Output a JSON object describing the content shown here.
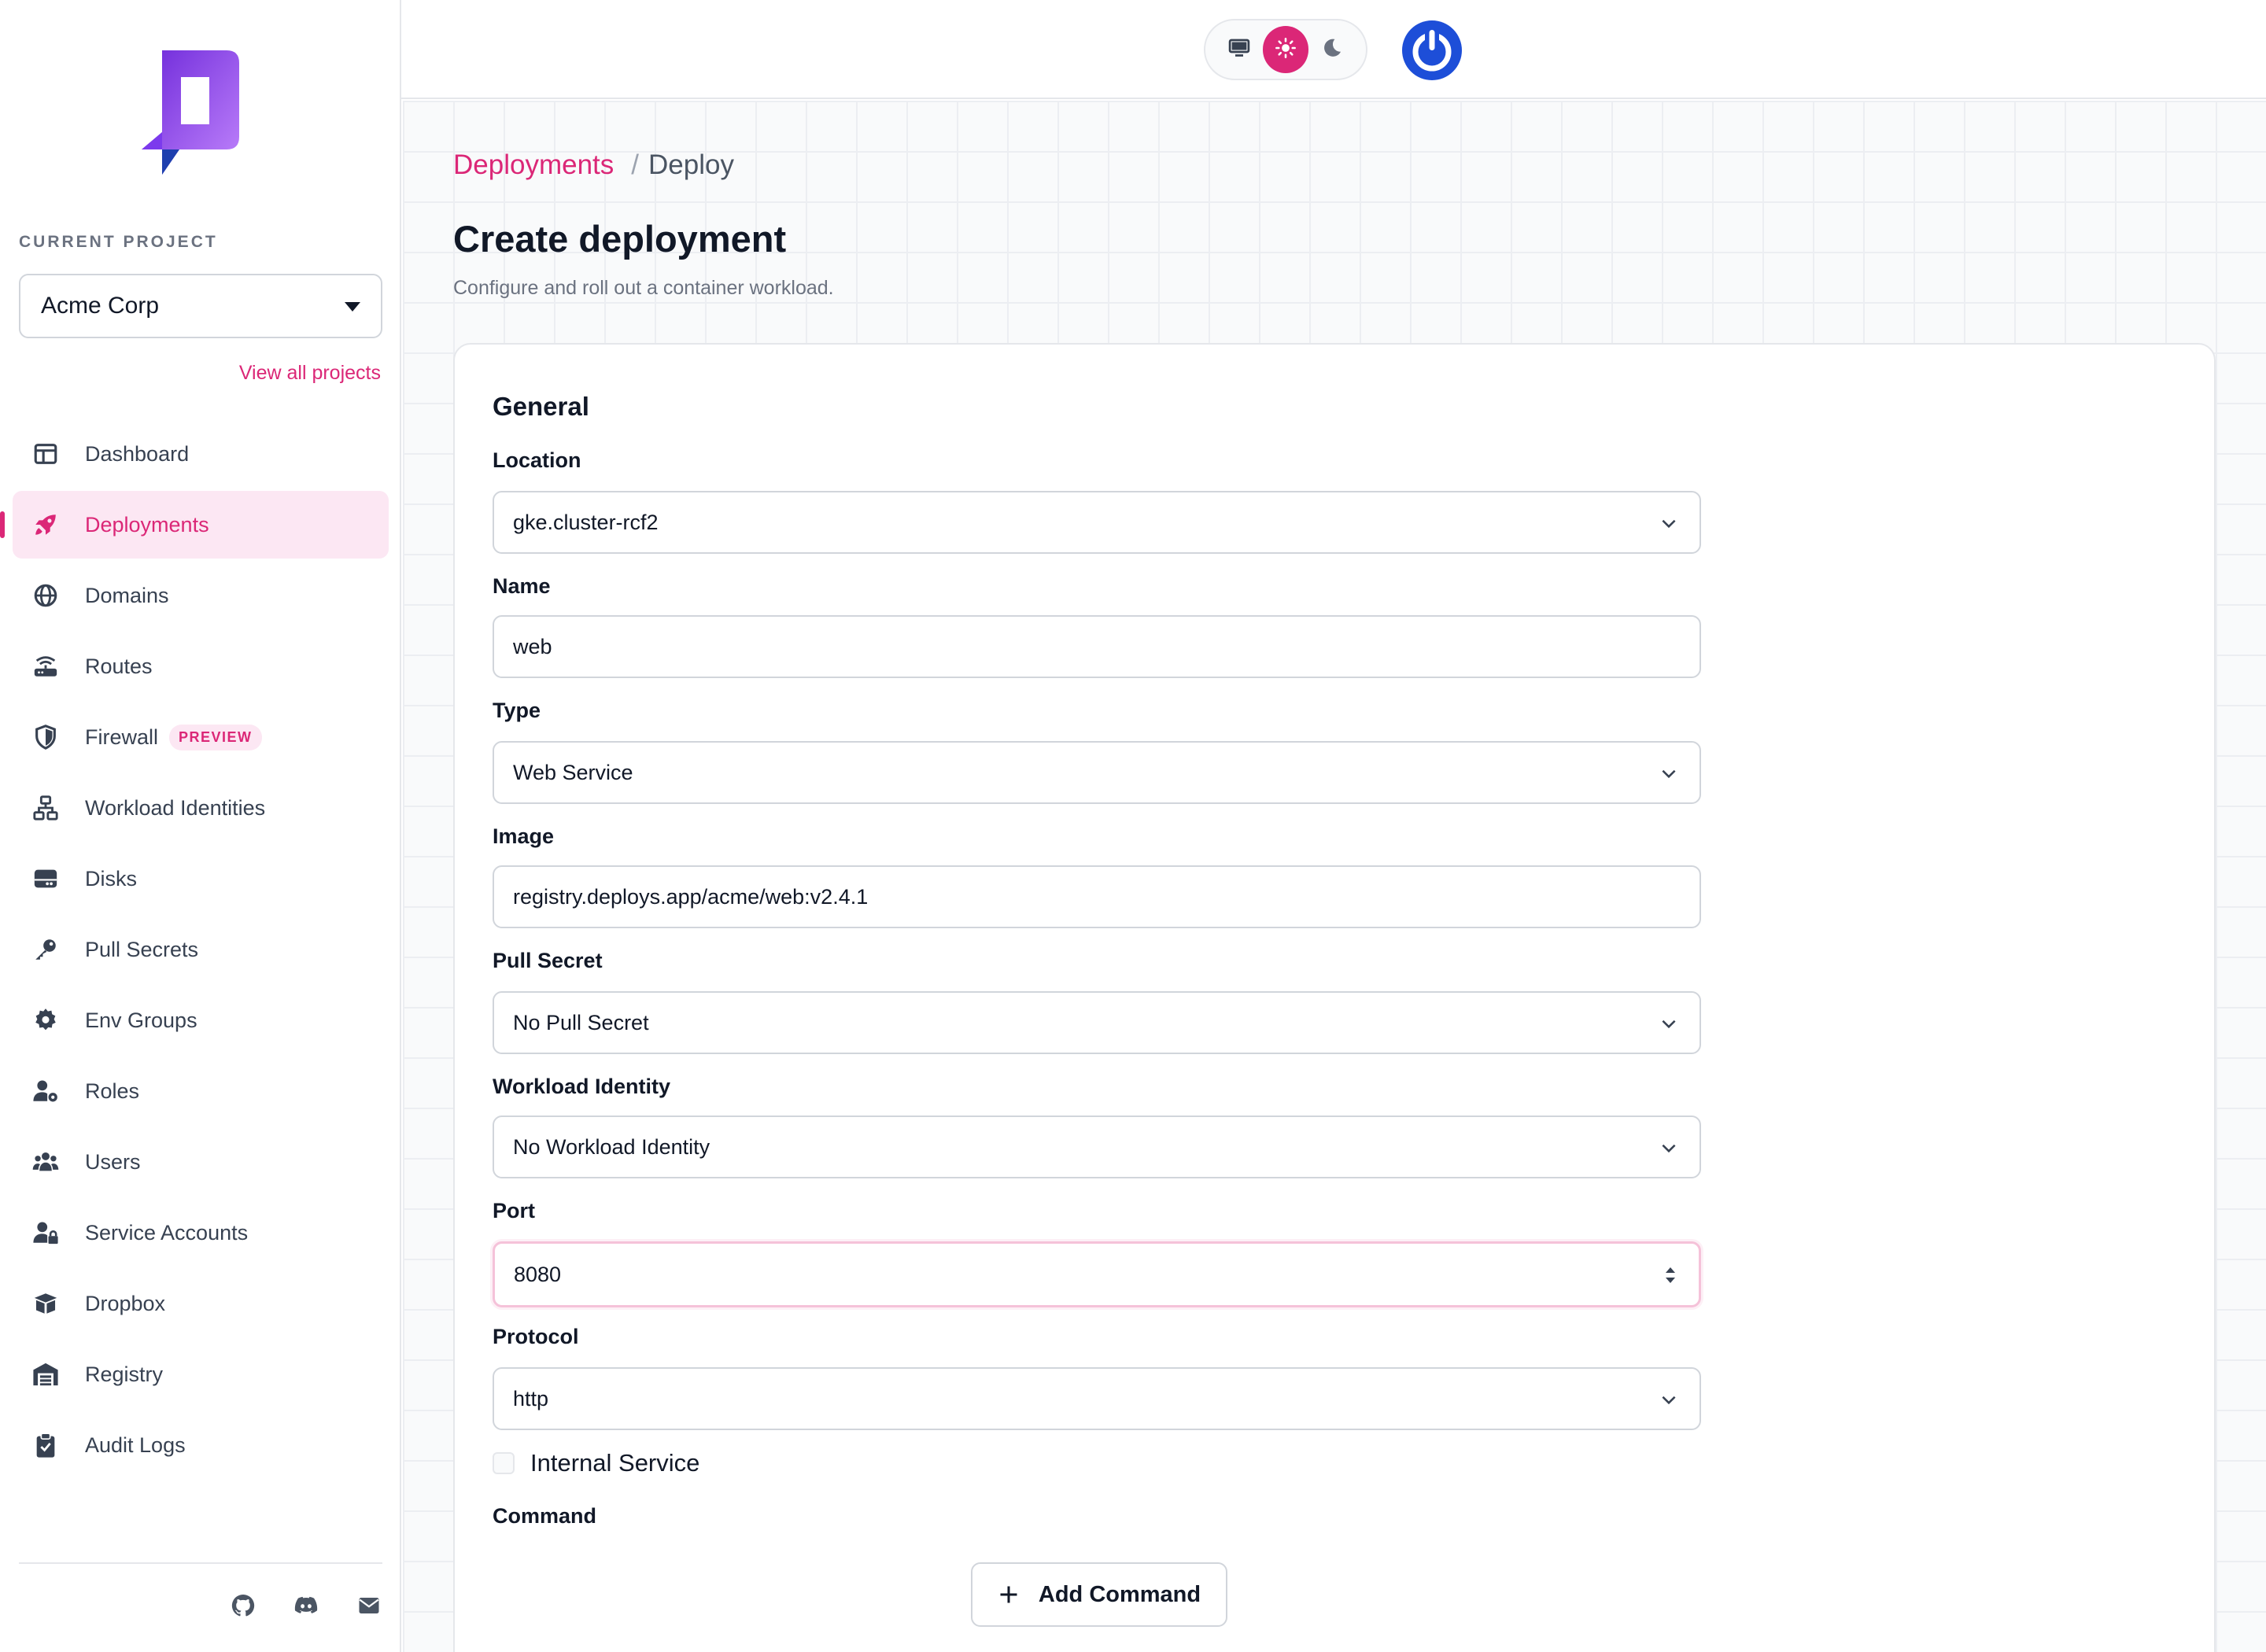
{
  "sidebar": {
    "current_project_label": "CURRENT PROJECT",
    "project": "Acme Corp",
    "view_all": "View all projects",
    "items": [
      {
        "label": "Dashboard",
        "icon": "dashboard-icon"
      },
      {
        "label": "Deployments",
        "icon": "rocket-icon",
        "active": true
      },
      {
        "label": "Domains",
        "icon": "globe-icon"
      },
      {
        "label": "Routes",
        "icon": "router-icon"
      },
      {
        "label": "Firewall",
        "icon": "shield-icon",
        "badge": "PREVIEW"
      },
      {
        "label": "Workload Identities",
        "icon": "network-icon"
      },
      {
        "label": "Disks",
        "icon": "disk-icon"
      },
      {
        "label": "Pull Secrets",
        "icon": "key-icon"
      },
      {
        "label": "Env Groups",
        "icon": "gear-icon"
      },
      {
        "label": "Roles",
        "icon": "user-gear-icon"
      },
      {
        "label": "Users",
        "icon": "users-icon"
      },
      {
        "label": "Service Accounts",
        "icon": "user-lock-icon"
      },
      {
        "label": "Dropbox",
        "icon": "box-icon"
      },
      {
        "label": "Registry",
        "icon": "warehouse-icon"
      },
      {
        "label": "Audit Logs",
        "icon": "clipboard-icon"
      }
    ],
    "footer_icons": [
      "github-icon",
      "discord-icon",
      "mail-icon"
    ]
  },
  "topbar": {
    "theme_options": [
      "monitor-icon",
      "sun-icon",
      "moon-icon"
    ],
    "theme_selected": "sun-icon"
  },
  "breadcrumb": {
    "parent": "Deployments",
    "separator": "/",
    "current": "Deploy"
  },
  "page": {
    "title": "Create deployment",
    "subtitle": "Configure and roll out a container workload."
  },
  "form": {
    "section": "General",
    "location": {
      "label": "Location",
      "value": "gke.cluster-rcf2"
    },
    "name": {
      "label": "Name",
      "value": "web"
    },
    "type": {
      "label": "Type",
      "value": "Web Service"
    },
    "image": {
      "label": "Image",
      "value": "registry.deploys.app/acme/web:v2.4.1"
    },
    "pull_secret": {
      "label": "Pull Secret",
      "value": "No Pull Secret"
    },
    "workload_identity": {
      "label": "Workload Identity",
      "value": "No Workload Identity"
    },
    "port": {
      "label": "Port",
      "value": "8080"
    },
    "protocol": {
      "label": "Protocol",
      "value": "http"
    },
    "internal_service": {
      "label": "Internal Service",
      "checked": false
    },
    "command": {
      "label": "Command",
      "add_label": "Add Command"
    }
  },
  "colors": {
    "accent": "#db2777",
    "accent_soft": "#fce7f3",
    "avatar_blue": "#1d4ed8"
  }
}
